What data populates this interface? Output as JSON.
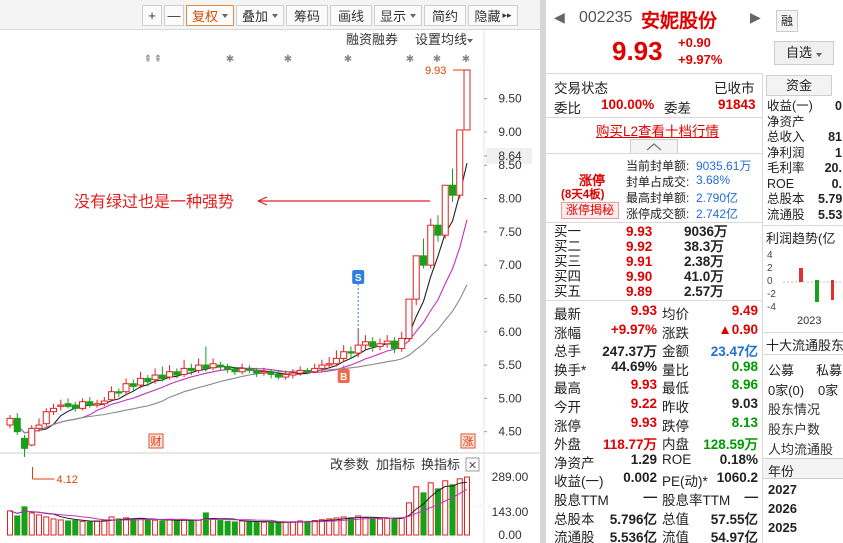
{
  "toolbar": {
    "plus": "+",
    "minus": "—",
    "buttons": [
      "复权",
      "叠加",
      "筹码",
      "画线",
      "显示",
      "简约",
      "隐藏"
    ],
    "more": "▸▸"
  },
  "chart_top": {
    "margin_trade": "融资融券",
    "ma_setting": "设置均线"
  },
  "annotation": "没有绿过也是一种强势",
  "markers": {
    "s": "S",
    "b": "B",
    "cai": "财",
    "zhang": "涨"
  },
  "chart_data": {
    "type": "candlestick",
    "price_axis_ticks": [
      "9.50",
      "9.00",
      "8.64",
      "8.50",
      "8.00",
      "7.50",
      "7.00",
      "6.50",
      "6.00",
      "5.50",
      "5.00",
      "4.50"
    ],
    "ylim": [
      4.3,
      9.93
    ],
    "current_price_label": "8.64",
    "high_label": "9.93",
    "low_label": "4.12",
    "candles": [
      [
        4.6,
        4.7,
        4.75,
        4.55
      ],
      [
        4.7,
        4.5,
        4.78,
        4.45
      ],
      [
        4.4,
        4.25,
        4.45,
        4.12
      ],
      [
        4.3,
        4.55,
        4.6,
        4.28
      ],
      [
        4.55,
        4.6,
        4.7,
        4.5
      ],
      [
        4.62,
        4.8,
        4.85,
        4.58
      ],
      [
        4.8,
        4.85,
        4.92,
        4.75
      ],
      [
        4.88,
        4.9,
        4.98,
        4.82
      ],
      [
        4.92,
        4.88,
        5.0,
        4.85
      ],
      [
        4.9,
        4.85,
        4.95,
        4.8
      ],
      [
        4.85,
        4.95,
        5.0,
        4.82
      ],
      [
        4.95,
        4.9,
        5.02,
        4.86
      ],
      [
        4.9,
        4.92,
        4.98,
        4.86
      ],
      [
        4.92,
        4.96,
        5.02,
        4.88
      ],
      [
        4.98,
        5.1,
        5.18,
        4.95
      ],
      [
        5.1,
        5.08,
        5.15,
        5.02
      ],
      [
        5.1,
        5.22,
        5.3,
        5.05
      ],
      [
        5.22,
        5.18,
        5.28,
        5.12
      ],
      [
        5.2,
        5.3,
        5.4,
        5.15
      ],
      [
        5.3,
        5.25,
        5.35,
        5.18
      ],
      [
        5.28,
        5.35,
        5.45,
        5.22
      ],
      [
        5.35,
        5.3,
        5.48,
        5.25
      ],
      [
        5.32,
        5.4,
        5.5,
        5.28
      ],
      [
        5.4,
        5.35,
        5.45,
        5.3
      ],
      [
        5.36,
        5.45,
        5.58,
        5.32
      ],
      [
        5.45,
        5.42,
        5.52,
        5.35
      ],
      [
        5.42,
        5.5,
        5.6,
        5.38
      ],
      [
        5.5,
        5.45,
        5.78,
        5.4
      ],
      [
        5.46,
        5.52,
        5.6,
        5.42
      ],
      [
        5.5,
        5.48,
        5.55,
        5.42
      ],
      [
        5.48,
        5.44,
        5.52,
        5.38
      ],
      [
        5.44,
        5.4,
        5.48,
        5.35
      ],
      [
        5.4,
        5.45,
        5.52,
        5.36
      ],
      [
        5.44,
        5.42,
        5.5,
        5.38
      ],
      [
        5.42,
        5.38,
        5.46,
        5.32
      ],
      [
        5.38,
        5.4,
        5.46,
        5.34
      ],
      [
        5.4,
        5.36,
        5.44,
        5.3
      ],
      [
        5.36,
        5.32,
        5.4,
        5.28
      ],
      [
        5.32,
        5.36,
        5.42,
        5.28
      ],
      [
        5.35,
        5.38,
        5.44,
        5.3
      ],
      [
        5.38,
        5.42,
        5.48,
        5.34
      ],
      [
        5.42,
        5.4,
        5.46,
        5.36
      ],
      [
        5.4,
        5.45,
        5.52,
        5.38
      ],
      [
        5.45,
        5.5,
        5.58,
        5.4
      ],
      [
        5.5,
        5.52,
        5.62,
        5.45
      ],
      [
        5.52,
        5.6,
        5.72,
        5.48
      ],
      [
        5.6,
        5.7,
        5.8,
        5.55
      ],
      [
        5.7,
        5.68,
        5.78,
        5.6
      ],
      [
        5.68,
        5.8,
        6.05,
        5.62
      ],
      [
        5.8,
        5.85,
        5.95,
        5.72
      ],
      [
        5.85,
        5.78,
        5.92,
        5.7
      ],
      [
        5.78,
        5.82,
        5.9,
        5.72
      ],
      [
        5.82,
        5.86,
        5.95,
        5.76
      ],
      [
        5.86,
        5.75,
        5.92,
        5.68
      ],
      [
        5.75,
        5.9,
        6.0,
        5.7
      ],
      [
        5.9,
        6.49,
        6.49,
        5.85
      ],
      [
        6.49,
        7.14,
        7.14,
        6.4
      ],
      [
        7.14,
        7.0,
        7.4,
        6.95
      ],
      [
        7.0,
        7.6,
        7.7,
        6.95
      ],
      [
        7.6,
        7.45,
        7.75,
        7.35
      ],
      [
        7.45,
        8.2,
        8.2,
        7.4
      ],
      [
        8.2,
        8.05,
        8.45,
        7.95
      ],
      [
        8.05,
        9.03,
        9.03,
        8.0
      ],
      [
        9.03,
        9.93,
        9.93,
        9.03
      ]
    ]
  },
  "volume_panel": {
    "buttons": [
      "改参数",
      "加指标",
      "换指标"
    ],
    "close": "✕",
    "axis_ticks": [
      "289.00",
      "143.00",
      "0.00"
    ],
    "ylim": [
      0,
      289
    ],
    "values": [
      120,
      95,
      140,
      110,
      100,
      90,
      80,
      75,
      70,
      72,
      68,
      65,
      70,
      72,
      90,
      80,
      85,
      78,
      82,
      76,
      74,
      70,
      75,
      72,
      78,
      70,
      74,
      110,
      80,
      72,
      68,
      65,
      70,
      68,
      66,
      64,
      62,
      60,
      64,
      66,
      70,
      68,
      72,
      76,
      80,
      85,
      90,
      86,
      95,
      88,
      84,
      80,
      82,
      78,
      86,
      160,
      240,
      210,
      260,
      230,
      270,
      250,
      280,
      289
    ]
  },
  "quote": {
    "code": "002235",
    "name": "安妮股份",
    "rzrq_tag": "融",
    "price": "9.93",
    "change": "+0.90",
    "change_pct": "+9.97%",
    "watch_btn": "自选",
    "status_label": "交易状态",
    "status_value": "已收市",
    "weibi_label": "委比",
    "weibi_value": "100.00%",
    "weicha_label": "委差",
    "weicha_value": "91843",
    "l2_link": "购买L2查看十档行情",
    "limit_tag": "涨停",
    "limit_days": "(8天4板)",
    "limit_btn": "涨停揭秘",
    "seal_rows": [
      {
        "label": "当前封单额:",
        "value": "9035.61万"
      },
      {
        "label": "封单占成交:",
        "value": "3.68%"
      },
      {
        "label": "最高封单额:",
        "value": "2.790亿"
      },
      {
        "label": "涨停成交额:",
        "value": "2.742亿"
      }
    ],
    "bids": [
      {
        "label": "买一",
        "price": "9.93",
        "vol": "9036万"
      },
      {
        "label": "买二",
        "price": "9.92",
        "vol": "38.3万"
      },
      {
        "label": "买三",
        "price": "9.91",
        "vol": "2.38万"
      },
      {
        "label": "买四",
        "price": "9.90",
        "vol": "41.0万"
      },
      {
        "label": "买五",
        "price": "9.89",
        "vol": "2.57万"
      }
    ],
    "stats": [
      [
        "最新",
        "9.93",
        "red",
        "均价",
        "9.49",
        "red"
      ],
      [
        "涨幅",
        "+9.97%",
        "red",
        "涨跌",
        "▲0.90",
        "red"
      ],
      [
        "总手",
        "247.37万",
        "blk",
        "金额",
        "23.47亿",
        "blu"
      ],
      [
        "换手*",
        "44.69%",
        "blk",
        "量比",
        "0.98",
        "grn"
      ],
      [
        "最高",
        "9.93",
        "red",
        "最低",
        "8.96",
        "grn"
      ],
      [
        "今开",
        "9.22",
        "red",
        "昨收",
        "9.03",
        "blk"
      ],
      [
        "涨停",
        "9.93",
        "red",
        "跌停",
        "8.13",
        "grn"
      ],
      [
        "外盘",
        "118.77万",
        "red",
        "内盘",
        "128.59万",
        "grn"
      ],
      [
        "净资产",
        "1.29",
        "blk",
        "ROE",
        "0.18%",
        "blk"
      ],
      [
        "收益(一)",
        "0.002",
        "blk",
        "PE(动)*",
        "1060.2",
        "blk"
      ],
      [
        "股息TTM",
        "—",
        "blk",
        "股息率TTM",
        "—",
        "blk"
      ],
      [
        "总股本",
        "5.796亿",
        "blk",
        "总值",
        "57.55亿",
        "blk"
      ],
      [
        "流通股",
        "5.536亿",
        "blk",
        "流值",
        "54.97亿",
        "blk"
      ]
    ]
  },
  "side": {
    "tab": "资金",
    "fund_rows": [
      "收益(一)",
      "净资产",
      "总收入",
      "净利润",
      "毛利率",
      "ROE",
      "总股本",
      "流通股"
    ],
    "fund_vals": [
      "0",
      "",
      "81",
      "1",
      "20.",
      "0.",
      "5.79",
      "5.53"
    ],
    "trend_title": "利润趋势(亿",
    "trend_ticks": [
      "4",
      "2",
      "0",
      "-2",
      "-4"
    ],
    "trend_year": "2023",
    "holders_title": "十大流通股东",
    "holder_labels": [
      "公募",
      "私募"
    ],
    "holder_vals": [
      "0家(0)",
      "0家"
    ],
    "info_rows": [
      "股东情况",
      "股东户数",
      "人均流通股"
    ],
    "year_label": "年份",
    "years": [
      "2027",
      "2026",
      "2025"
    ]
  }
}
